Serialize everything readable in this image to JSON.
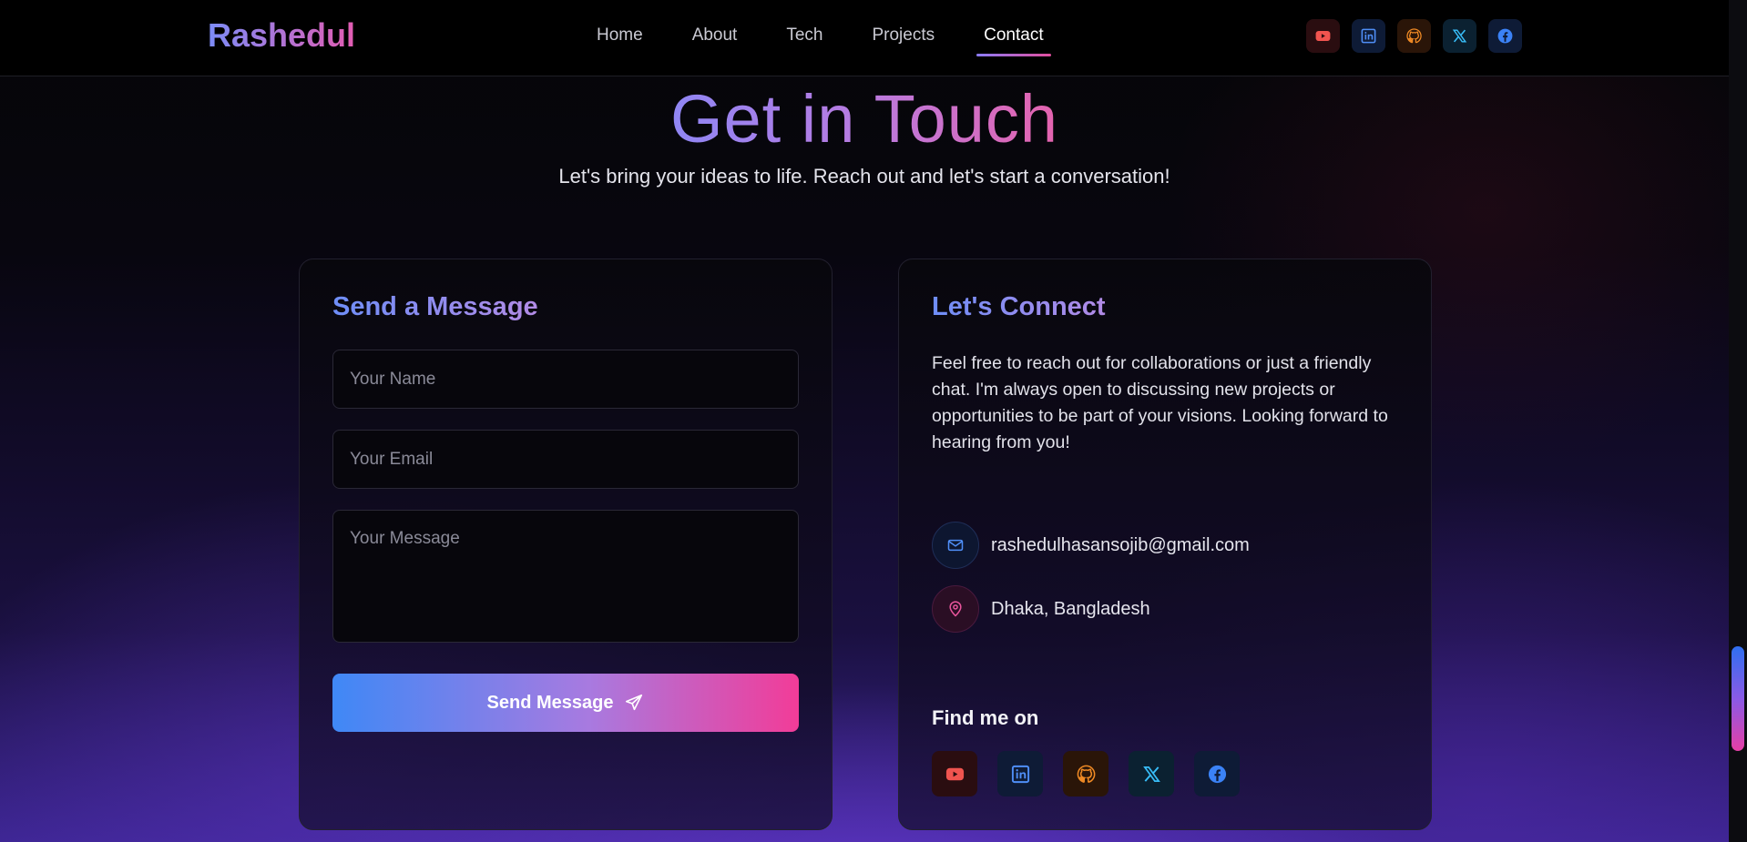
{
  "nav": {
    "brand": "Rashedul",
    "links": [
      {
        "label": "Home",
        "active": false
      },
      {
        "label": "About",
        "active": false
      },
      {
        "label": "Tech",
        "active": false
      },
      {
        "label": "Projects",
        "active": false
      },
      {
        "label": "Contact",
        "active": true
      }
    ],
    "social_icons": [
      "youtube-icon",
      "linkedin-icon",
      "github-icon",
      "x-icon",
      "facebook-icon"
    ]
  },
  "hero": {
    "title": "Get in Touch",
    "subtitle": "Let's bring your ideas to life. Reach out and let's start a conversation!"
  },
  "form": {
    "title": "Send a Message",
    "name_placeholder": "Your Name",
    "email_placeholder": "Your Email",
    "message_placeholder": "Your Message",
    "submit_label": "Send Message",
    "submit_icon": "send-icon"
  },
  "connect": {
    "title": "Let's Connect",
    "description": "Feel free to reach out for collaborations or just a friendly chat. I'm always open to discussing new projects or opportunities to be part of your visions. Looking forward to hearing from you!",
    "email": "rashedulhasansojib@gmail.com",
    "location": "Dhaka, Bangladesh",
    "find_title": "Find me on",
    "social_icons": [
      "youtube-icon",
      "linkedin-icon",
      "github-icon",
      "x-icon",
      "facebook-icon"
    ]
  },
  "colors": {
    "youtube": "#f0544f",
    "linkedin": "#3b82f6",
    "github": "#f08a24",
    "x": "#38bdf8",
    "facebook": "#3b82f6",
    "accent_start": "#3f88f6",
    "accent_end": "#f23c98"
  }
}
